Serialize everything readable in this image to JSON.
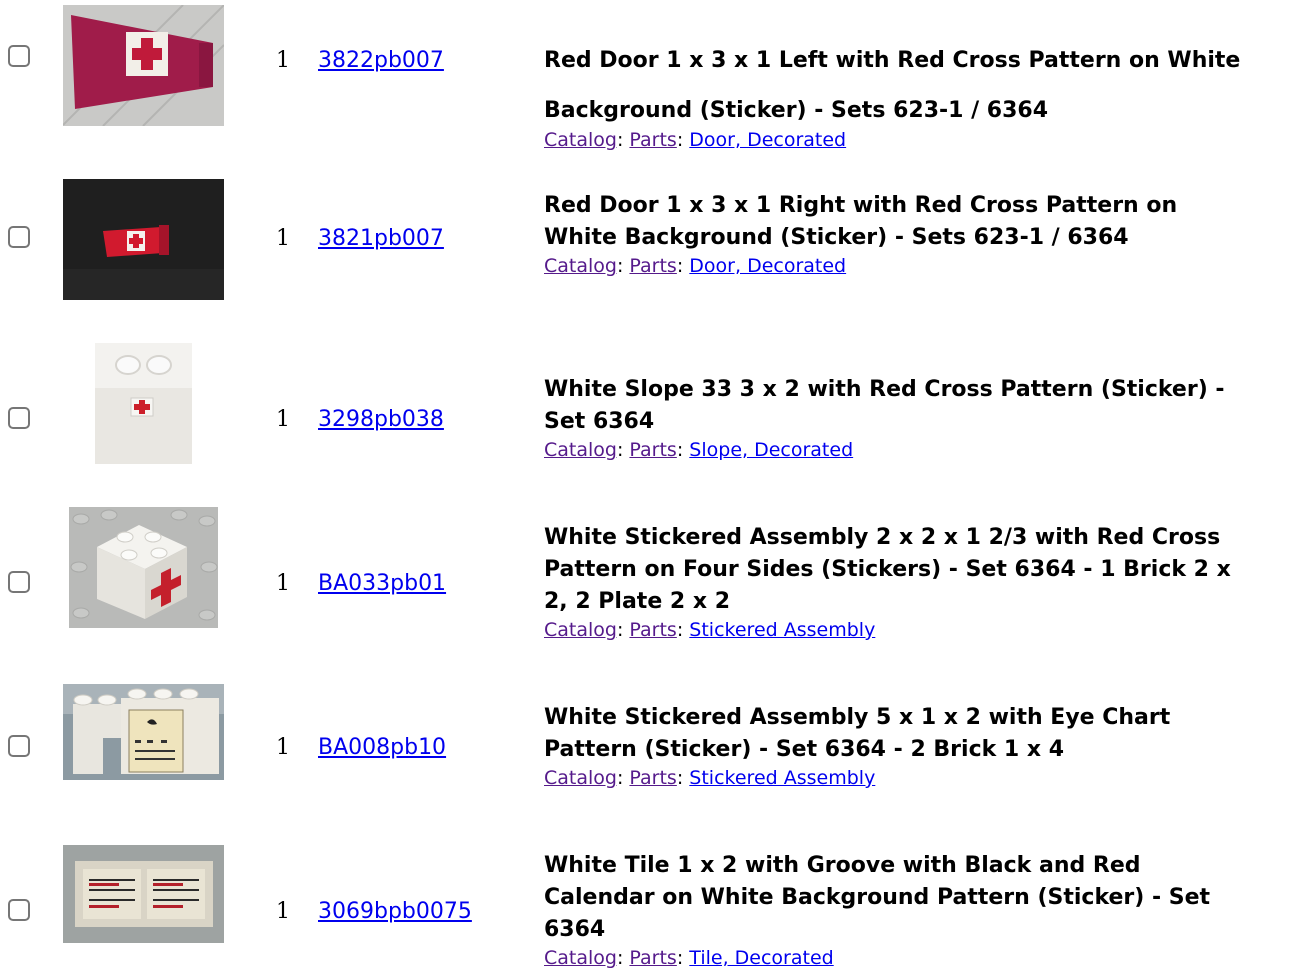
{
  "items": [
    {
      "qty": "1",
      "part_no": "3822pb007",
      "title": "Red Door 1 x 3 x 1 Left with Red Cross Pattern on White\nBackground (Sticker) - Sets 623-1 / 6364",
      "crumb_catalog": "Catalog",
      "crumb_parts": "Parts",
      "crumb_category": "Door, Decorated"
    },
    {
      "qty": "1",
      "part_no": "3821pb007",
      "title": "Red Door 1 x 3 x 1 Right with Red Cross Pattern on\nWhite Background (Sticker) - Sets 623-1 / 6364",
      "crumb_catalog": "Catalog",
      "crumb_parts": "Parts",
      "crumb_category": "Door, Decorated"
    },
    {
      "qty": "1",
      "part_no": "3298pb038",
      "title": "White Slope 33 3 x 2 with Red Cross Pattern (Sticker) -\nSet 6364",
      "crumb_catalog": "Catalog",
      "crumb_parts": "Parts",
      "crumb_category": "Slope, Decorated"
    },
    {
      "qty": "1",
      "part_no": "BA033pb01",
      "title": "White Stickered Assembly 2 x 2 x 1 2/3 with Red Cross\nPattern on Four Sides (Stickers) - Set 6364 - 1 Brick 2 x\n2, 2 Plate 2 x 2",
      "crumb_catalog": "Catalog",
      "crumb_parts": "Parts",
      "crumb_category": "Stickered Assembly"
    },
    {
      "qty": "1",
      "part_no": "BA008pb10",
      "title": "White Stickered Assembly 5 x 1 x 2 with Eye Chart\nPattern (Sticker) - Set 6364 - 2 Brick 1 x 4",
      "crumb_catalog": "Catalog",
      "crumb_parts": "Parts",
      "crumb_category": "Stickered Assembly"
    },
    {
      "qty": "1",
      "part_no": "3069bpb0075",
      "title": "White Tile 1 x 2 with Groove with Black and Red\nCalendar on White Background Pattern (Sticker) - Set\n6364",
      "crumb_catalog": "Catalog",
      "crumb_parts": "Parts",
      "crumb_category": "Tile, Decorated"
    }
  ],
  "separator": ": ",
  "colors": {
    "link": "#0000ee",
    "visited": "#551a8b"
  }
}
